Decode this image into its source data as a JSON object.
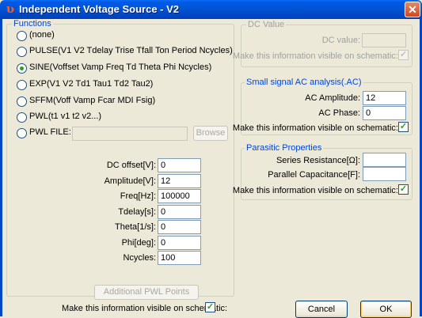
{
  "window": {
    "title": "Independent Voltage Source - V2",
    "close_glyph": "✕",
    "icon": "source-icon"
  },
  "functions": {
    "legend": "Functions",
    "selected": "SINE",
    "options": [
      {
        "label": "(none)",
        "checked": false
      },
      {
        "label": "PULSE(V1 V2 Tdelay Trise Tfall Ton Period Ncycles)",
        "checked": false
      },
      {
        "label": "SINE(Voffset Vamp Freq Td Theta Phi Ncycles)",
        "checked": true
      },
      {
        "label": "EXP(V1 V2 Td1 Tau1 Td2 Tau2)",
        "checked": false
      },
      {
        "label": "SFFM(Voff Vamp Fcar MDI Fsig)",
        "checked": false
      },
      {
        "label": "PWL(t1 v1 t2 v2...)",
        "checked": false
      },
      {
        "label": "PWL FILE:",
        "checked": false
      }
    ],
    "pwl_file_value": "",
    "browse_label": "Browse",
    "params": [
      {
        "label": "DC offset[V]:",
        "value": "0"
      },
      {
        "label": "Amplitude[V]:",
        "value": "12"
      },
      {
        "label": "Freq[Hz]:",
        "value": "100000"
      },
      {
        "label": "Tdelay[s]:",
        "value": "0"
      },
      {
        "label": "Theta[1/s]:",
        "value": "0"
      },
      {
        "label": "Phi[deg]:",
        "value": "0"
      },
      {
        "label": "Ncycles:",
        "value": "100"
      }
    ],
    "pwl_points_label": "Additional PWL Points",
    "visible_label": "Make this information visible on schematic:",
    "visible_checked": true
  },
  "dc_value": {
    "legend": "DC Value",
    "label": "DC value:",
    "value": "",
    "visible_label": "Make this information visible on schematic:",
    "visible_checked": true
  },
  "ac": {
    "legend": "Small signal AC analysis(.AC)",
    "amplitude_label": "AC Amplitude:",
    "amplitude_value": "12",
    "phase_label": "AC Phase:",
    "phase_value": "0",
    "visible_label": "Make this information visible on schematic:",
    "visible_checked": true
  },
  "parasitic": {
    "legend": "Parasitic Properties",
    "resistance_label": "Series Resistance[Ω]:",
    "resistance_value": "",
    "capacitance_label": "Parallel Capacitance[F]:",
    "capacitance_value": "",
    "visible_label": "Make this information visible on schematic:",
    "visible_checked": true
  },
  "buttons": {
    "cancel": "Cancel",
    "ok": "OK"
  },
  "check_glyph": "✓"
}
